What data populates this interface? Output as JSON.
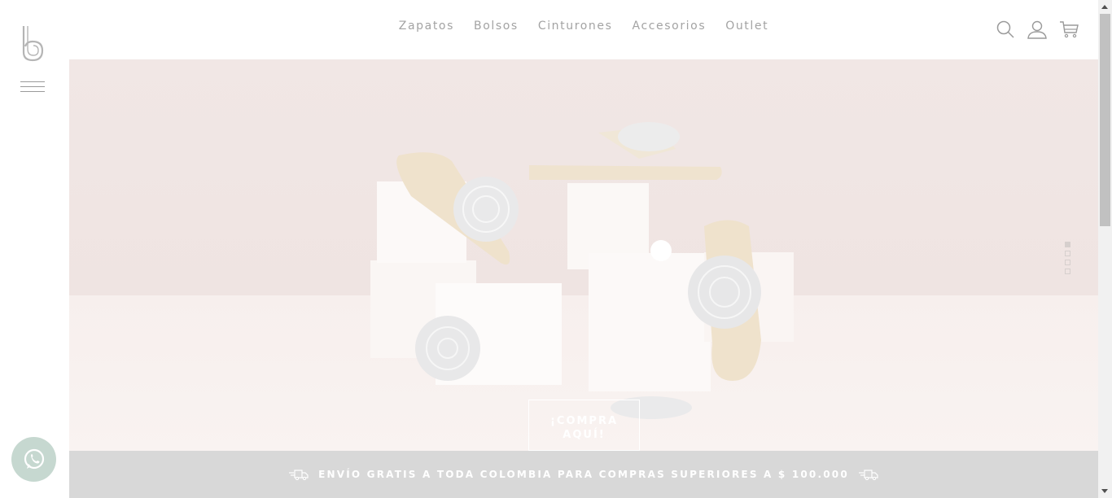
{
  "brand": {
    "logo_icon": "b-logo-icon"
  },
  "sidebar": {
    "menu_icon": "hamburger-icon"
  },
  "nav": {
    "items": [
      {
        "label": "Zapatos"
      },
      {
        "label": "Bolsos"
      },
      {
        "label": "Cinturones"
      },
      {
        "label": "Accesorios"
      },
      {
        "label": "Outlet"
      }
    ]
  },
  "header_icons": [
    "search-icon",
    "user-icon",
    "cart-icon"
  ],
  "hero": {
    "cta_line1": "¡COMPRA",
    "cta_line2": "AQUÍ!",
    "slides_count": 4,
    "active_slide": 1
  },
  "shipping_bar": {
    "text": "ENVÍO GRATIS A TODA COLOMBIA PARA COMPRAS SUPERIORES A $ 100.000",
    "icon": "delivery-truck-icon"
  },
  "floating": {
    "icon": "whatsapp-icon"
  },
  "colors": {
    "nav_text": "#a3a3a3",
    "hero_bg": "#f3e9e7",
    "shipping_bar_bg": "#d8d8d8",
    "whatsapp_bg": "#c6d8d0"
  }
}
